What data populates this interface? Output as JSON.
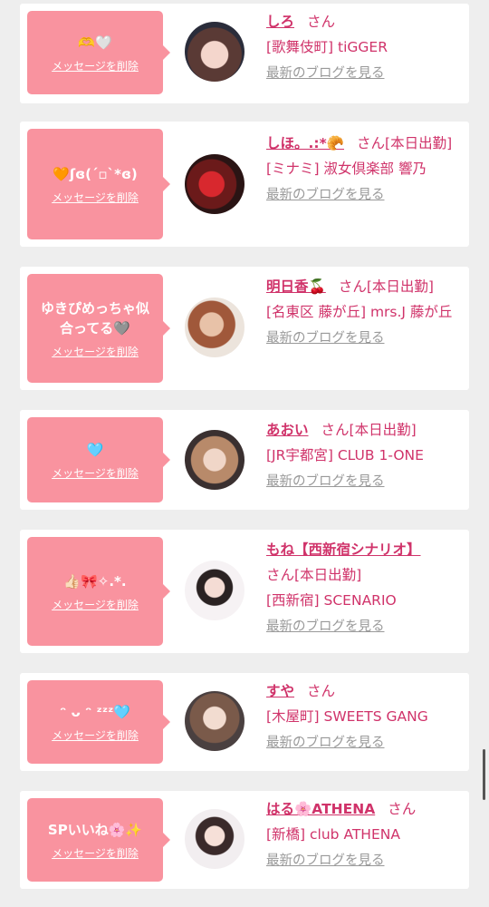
{
  "delete_label": "メッセージを削除",
  "blog_label": "最新のブログを見る",
  "san_label": "さん",
  "accent_color": "#f9939f",
  "name_color": "#d0336a",
  "cards": [
    {
      "message": "🫶🤍",
      "name": "しろ",
      "status": "",
      "shop_line": "[歌舞伎町] tiGGER"
    },
    {
      "message": "🧡ʃɞ(ˊ▫ˋ*ɞ)",
      "name": "しほ。.:*🥐",
      "status": "[本日出勤]",
      "shop_line": "[ミナミ] 淑女倶楽部 響乃"
    },
    {
      "message": "ゆきぴめっちゃ似合ってる🩶",
      "name": "明日香🍒",
      "status": "[本日出勤]",
      "shop_line": "[名東区 藤が丘] mrs.J 藤が丘"
    },
    {
      "message": "🩵",
      "name": "あおい",
      "status": "[本日出勤]",
      "shop_line": "[JR宇都宮] CLUB 1-ONE"
    },
    {
      "message": "👍🏻🎀✧.*.",
      "name": "もね【西新宿シナリオ】",
      "status": "[本日出勤]",
      "shop_line": "[西新宿] SCENARIO"
    },
    {
      "message": "ᵔ ᴗ ᵔ ᶻᶻᶻ🩵",
      "name": "すや",
      "status": "",
      "shop_line": "[木屋町] SWEETS GANG"
    },
    {
      "message": "SPいいね🌸✨",
      "name": "はる🌸ATHENA",
      "status": "",
      "shop_line": "[新橋] club ATHENA"
    }
  ]
}
